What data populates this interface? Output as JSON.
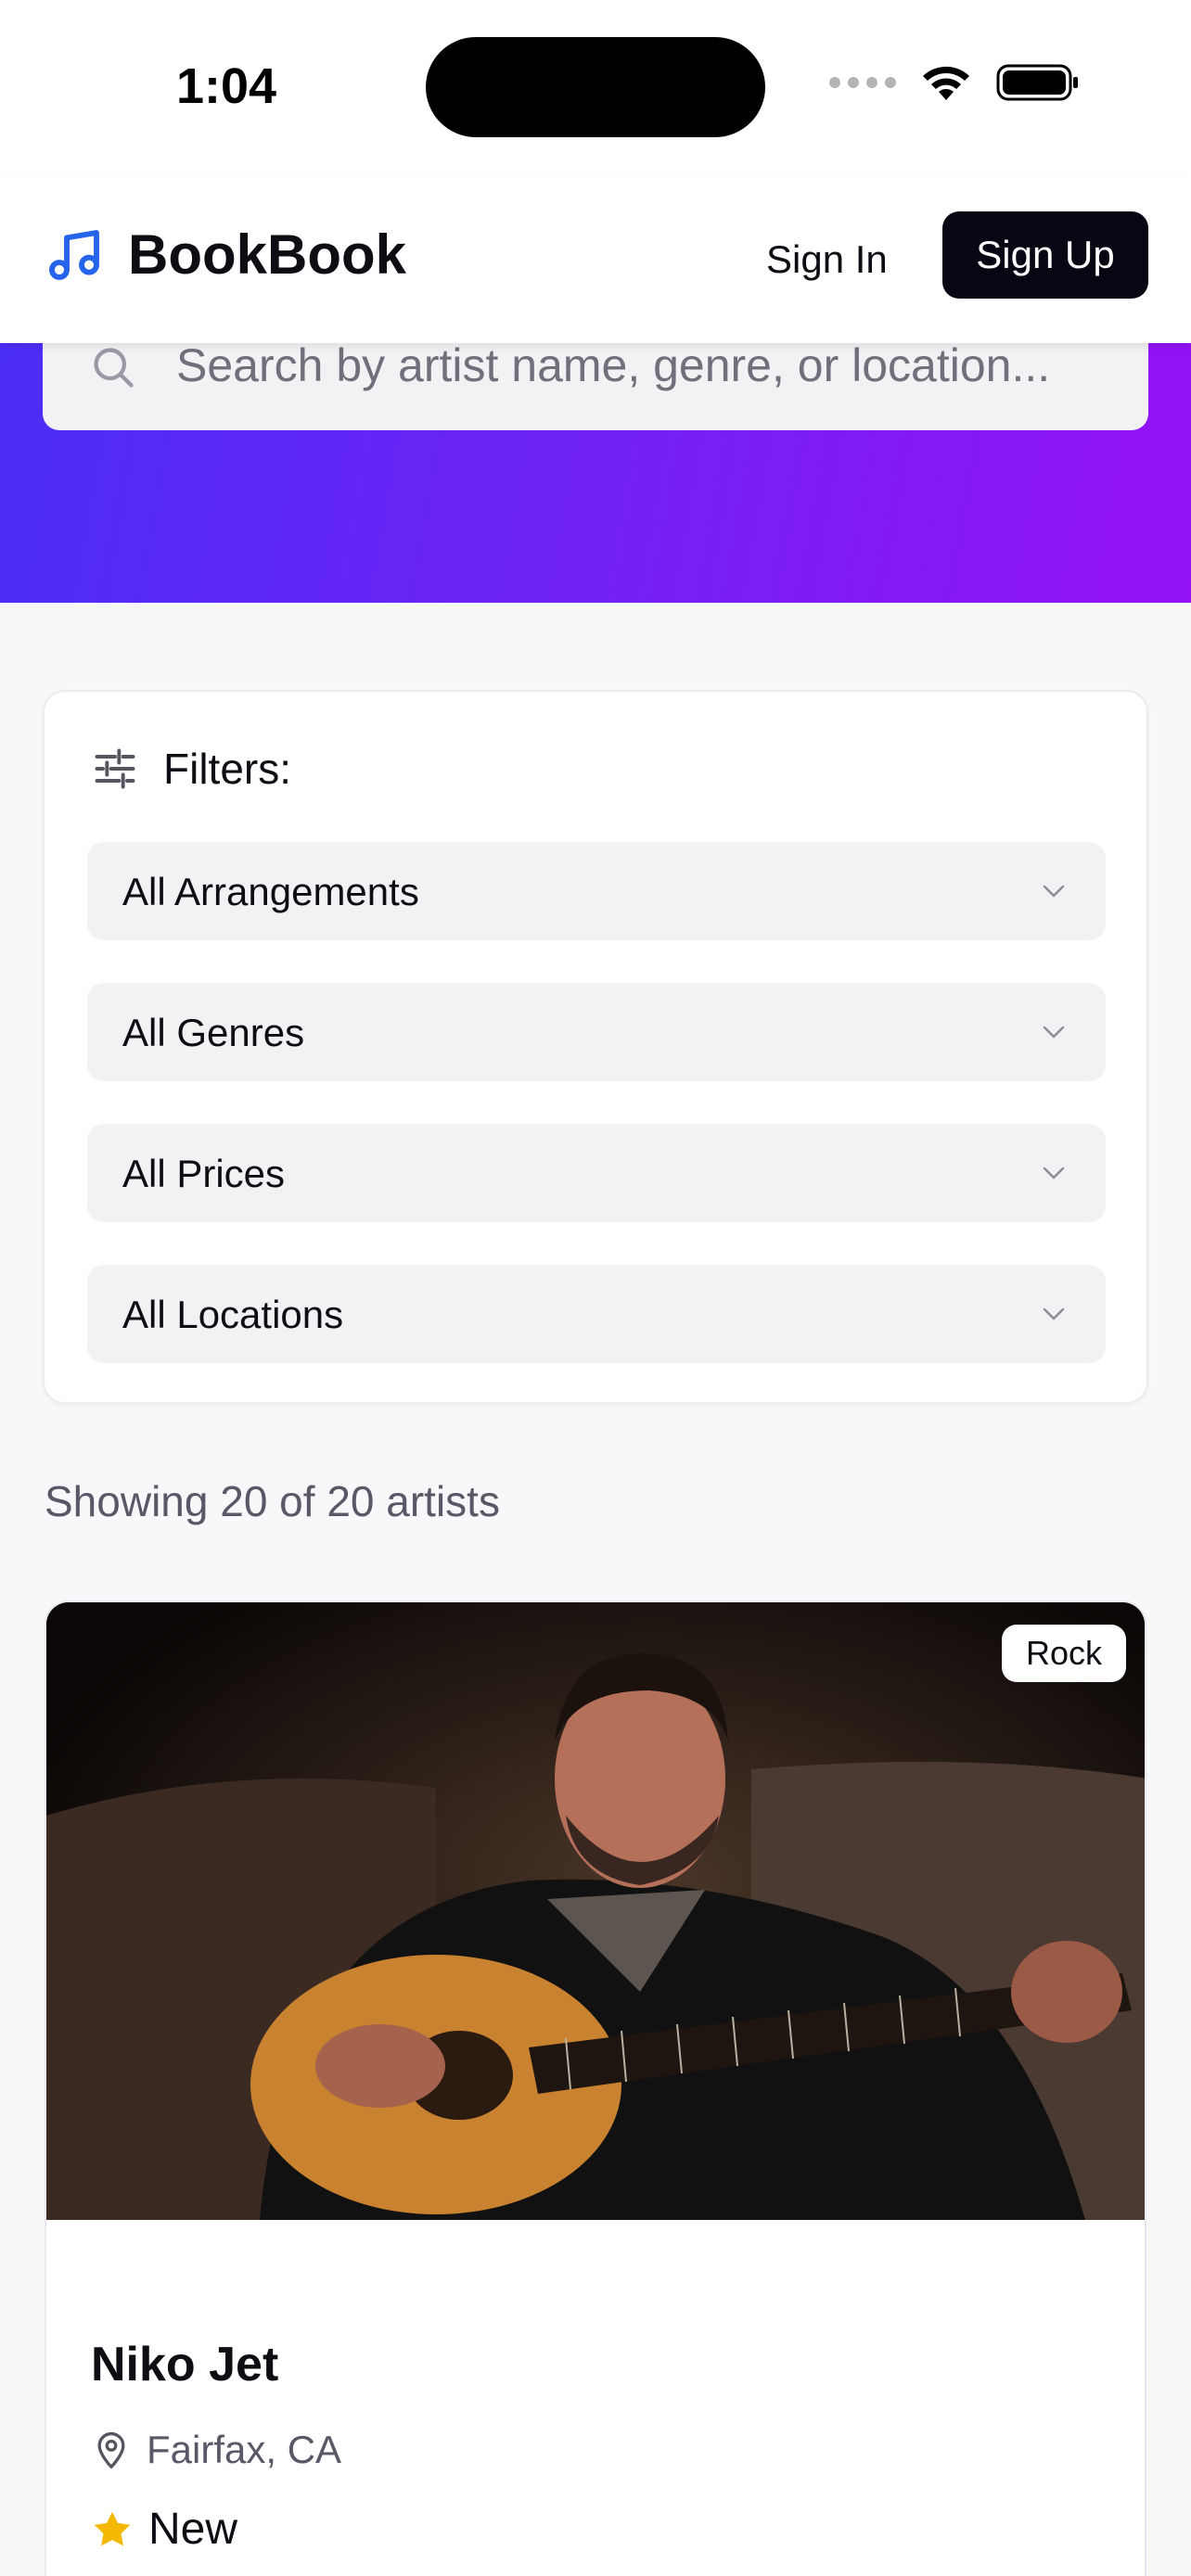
{
  "status_bar": {
    "time": "1:04"
  },
  "header": {
    "brand": "BookBook",
    "sign_in": "Sign In",
    "sign_up": "Sign Up",
    "accent_color": "#2563eb"
  },
  "search": {
    "placeholder": "Search by artist name, genre, or location..."
  },
  "filters": {
    "label": "Filters:",
    "selects": [
      {
        "value": "All Arrangements"
      },
      {
        "value": "All Genres"
      },
      {
        "value": "All Prices"
      },
      {
        "value": "All Locations"
      }
    ]
  },
  "results": {
    "count_text": "Showing 20 of 20 artists"
  },
  "artists": [
    {
      "name": "Niko Jet",
      "genre": "Rock",
      "location": "Fairfax, CA",
      "rating": "New"
    }
  ],
  "colors": {
    "hero_gradient_start": "#4b2ef6",
    "hero_gradient_end": "#9512f6",
    "primary_button": "#070714",
    "star": "#f5b800"
  }
}
